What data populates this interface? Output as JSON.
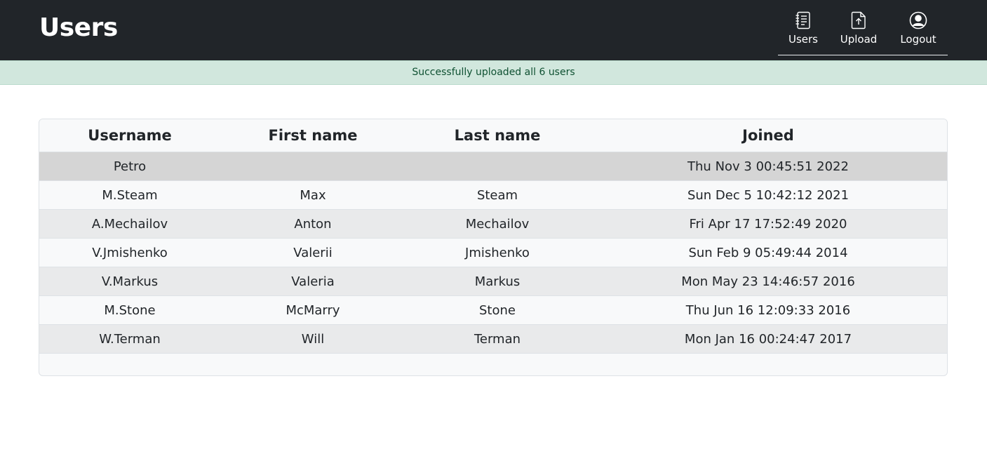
{
  "header": {
    "title": "Users",
    "nav": [
      {
        "label": "Users",
        "icon": "journal-icon"
      },
      {
        "label": "Upload",
        "icon": "upload-file-icon"
      },
      {
        "label": "Logout",
        "icon": "person-circle-icon"
      }
    ]
  },
  "alert": {
    "message": "Successfully uploaded all 6 users",
    "color": "#d1e7dd"
  },
  "table": {
    "columns": [
      "Username",
      "First name",
      "Last name",
      "Joined"
    ],
    "rows": [
      {
        "username": "Petro",
        "first": "",
        "last": "",
        "joined": "Thu Nov 3 00:45:51 2022"
      },
      {
        "username": "M.Steam",
        "first": "Max",
        "last": "Steam",
        "joined": "Sun Dec 5 10:42:12 2021"
      },
      {
        "username": "A.Mechailov",
        "first": "Anton",
        "last": "Mechailov",
        "joined": "Fri Apr 17 17:52:49 2020"
      },
      {
        "username": "V.Jmishenko",
        "first": "Valerii",
        "last": "Jmishenko",
        "joined": "Sun Feb 9 05:49:44 2014"
      },
      {
        "username": "V.Markus",
        "first": "Valeria",
        "last": "Markus",
        "joined": "Mon May 23 14:46:57 2016"
      },
      {
        "username": "M.Stone",
        "first": "McMarry",
        "last": "Stone",
        "joined": "Thu Jun 16 12:09:33 2016"
      },
      {
        "username": "W.Terman",
        "first": "Will",
        "last": "Terman",
        "joined": "Mon Jan 16 00:24:47 2017"
      }
    ]
  }
}
